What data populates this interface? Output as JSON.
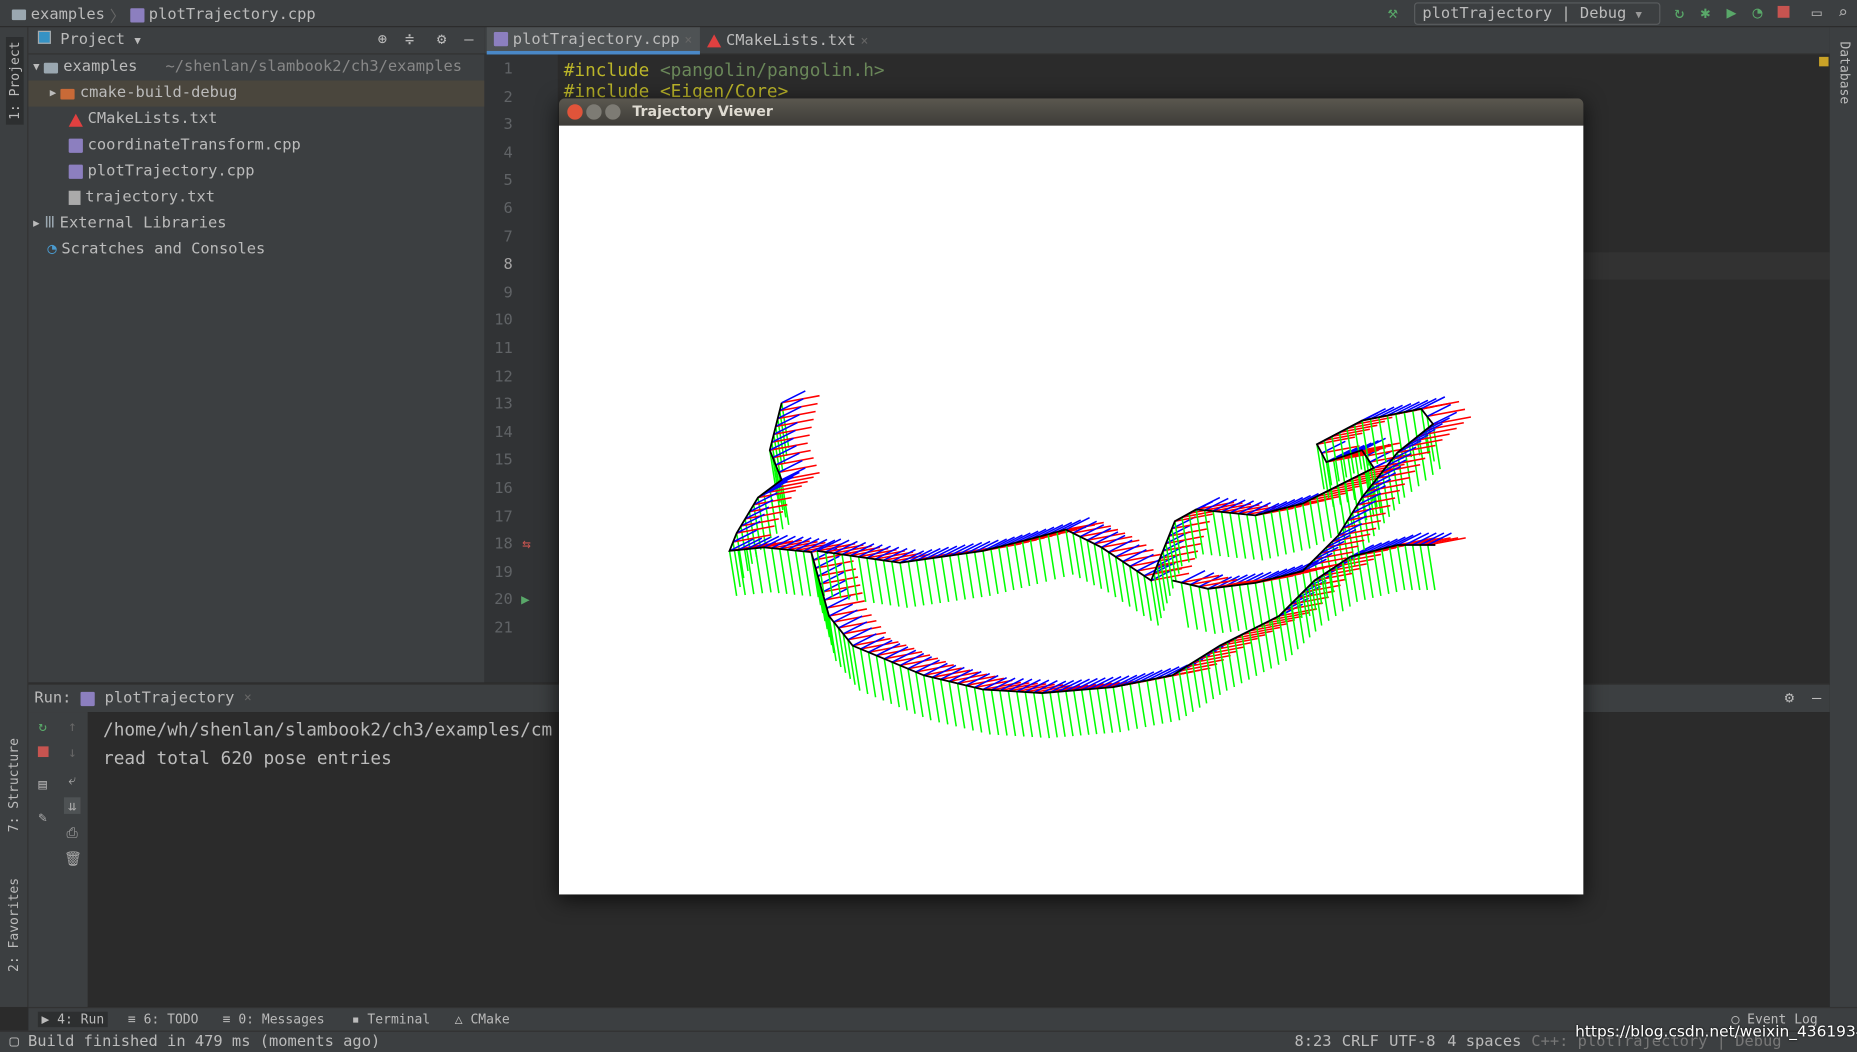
{
  "breadcrumb": {
    "folder": "examples",
    "file": "plotTrajectory.cpp"
  },
  "toolbar": {
    "run_config": "plotTrajectory | Debug",
    "icons": [
      "build-hammer-icon",
      "rerun-icon",
      "debug-bug-icon",
      "coverage-icon",
      "profile-icon",
      "stop-icon",
      "layout-icon",
      "search-icon"
    ]
  },
  "left_strip": {
    "project": "1: Project",
    "structure": "7: Structure",
    "favorites": "2: Favorites"
  },
  "right_strip": {
    "database": "Database"
  },
  "project": {
    "title": "Project",
    "root": "examples",
    "root_path": "~/shenlan/slambook2/ch3/examples",
    "items": [
      "cmake-build-debug",
      "CMakeLists.txt",
      "coordinateTransform.cpp",
      "plotTrajectory.cpp",
      "trajectory.txt"
    ],
    "external": "External Libraries",
    "scratches": "Scratches and Consoles"
  },
  "editor": {
    "tabs": [
      "plotTrajectory.cpp",
      "CMakeLists.txt"
    ],
    "lines": [
      "1",
      "2",
      "3",
      "4",
      "5",
      "6",
      "7",
      "8",
      "9",
      "10",
      "11",
      "12",
      "13",
      "14",
      "15",
      "16",
      "17",
      "18",
      "19",
      "20",
      "21"
    ],
    "code_line1_kw": "#include",
    "code_line1_path": "<pangolin/pangolin.h>",
    "code_line2": "#include <Eigen/Core>"
  },
  "run": {
    "label": "Run:",
    "tab": "plotTrajectory",
    "console": [
      "/home/wh/shenlan/slambook2/ch3/examples/cm",
      "read total 620 pose entries"
    ]
  },
  "bottom_tabs": [
    "4: Run",
    "6: TODO",
    "0: Messages",
    "Terminal",
    "CMake",
    "Event Log"
  ],
  "status": {
    "message": "Build finished in 479 ms (moments ago)",
    "position": "8:23",
    "line_sep": "CRLF",
    "encoding": "UTF-8",
    "indent": "4 spaces",
    "context": "C++: plotTrajectory | Debug"
  },
  "viewer": {
    "title": "Trajectory Viewer",
    "axis_colors": {
      "x": "#ff0000",
      "y": "#00ff00",
      "z": "#0000ff",
      "path": "#000000"
    }
  },
  "watermark": "https://blog.csdn.net/weixin_43619346"
}
